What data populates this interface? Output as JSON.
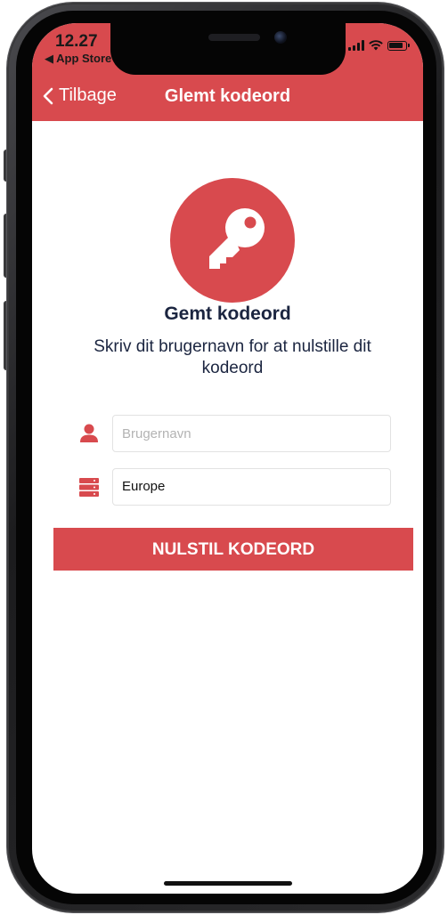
{
  "status_bar": {
    "time": "12.27",
    "back_app": "◀ App Store"
  },
  "nav": {
    "back_label": "Tilbage",
    "title": "Glemt kodeord"
  },
  "content": {
    "icon": "key-icon",
    "heading": "Gemt kodeord",
    "instruction": "Skriv dit brugernavn for at nulstille dit kodeord"
  },
  "form": {
    "username": {
      "icon": "user-icon",
      "placeholder": "Brugernavn",
      "value": ""
    },
    "server": {
      "icon": "server-icon",
      "value": "Europe"
    },
    "submit_label": "NULSTIL KODEORD"
  },
  "colors": {
    "accent": "#d84a4e",
    "heading_text": "#1b2540"
  }
}
